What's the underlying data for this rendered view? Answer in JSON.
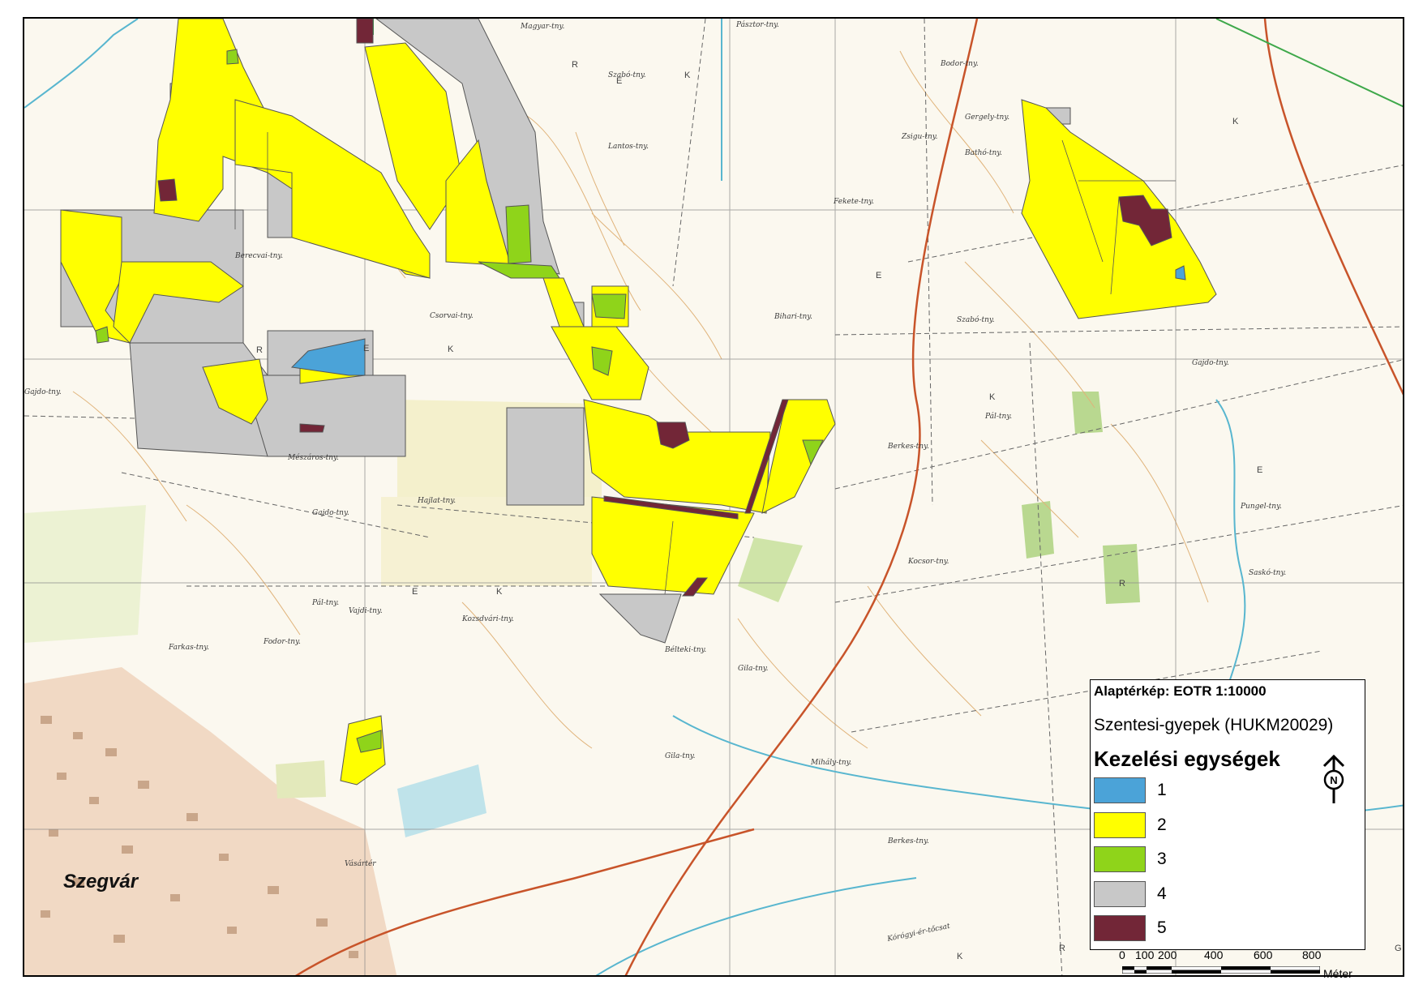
{
  "map": {
    "town_label": "Szegvár",
    "place_names": [
      "Magyar-tny.",
      "Pásztor-tny.",
      "Bodor-tny.",
      "Szabó-tny.",
      "Gergely-tny.",
      "Zsigu-tny.",
      "Bathó-tny.",
      "Lantos-tny.",
      "Fekete-tny.",
      "Berecvai-tny.",
      "Csorvai-tny.",
      "Bihari-tny.",
      "Szabó-tny.",
      "Gajdo-tny.",
      "Gajdo-tny.",
      "Pál-tny.",
      "Berkes-tny.",
      "Mészáros-tny.",
      "Hajlat-tny.",
      "Gajdo-tny.",
      "Pál-tny.",
      "Vajdi-tny.",
      "Kozsdvári-tny.",
      "Kocsor-tny.",
      "Fodor-tny.",
      "Farkas-tny.",
      "Bélteki-tny.",
      "Gila-tny.",
      "Gila-tny.",
      "Mihály-tny.",
      "Berkes-tny.",
      "Pungel-tny.",
      "Saskó-tny.",
      "Kórógyi-ér-tőcsat",
      "Vásártér"
    ],
    "sheet_letters": [
      "R",
      "E",
      "K",
      "E",
      "K",
      "R",
      "E",
      "K",
      "R",
      "E",
      "K",
      "E",
      "K",
      "G",
      "K",
      "R",
      "E"
    ]
  },
  "legend": {
    "basemap_label": "Alaptérkép: EOTR 1:10000",
    "site_label": "Szentesi-gyepek (HUKM20029)",
    "heading": "Kezelési egységek",
    "north_label": "N",
    "items": [
      {
        "label": "1",
        "color": "#4ba3d8"
      },
      {
        "label": "2",
        "color": "#ffff00"
      },
      {
        "label": "3",
        "color": "#8fd41a"
      },
      {
        "label": "4",
        "color": "#c8c8c8"
      },
      {
        "label": "5",
        "color": "#722637"
      }
    ]
  },
  "scale": {
    "ticks": [
      "0",
      "100",
      "200",
      "400",
      "600",
      "800"
    ],
    "unit": "Méter"
  },
  "colors": {
    "unit1": "#4ba3d8",
    "unit2": "#ffff00",
    "unit3": "#8fd41a",
    "unit4": "#c8c8c8",
    "unit5": "#722637",
    "basemap_bg": "#fbf8ef",
    "contour": "#e0b37a",
    "road": "#c8542a",
    "water": "#58b6cf"
  }
}
